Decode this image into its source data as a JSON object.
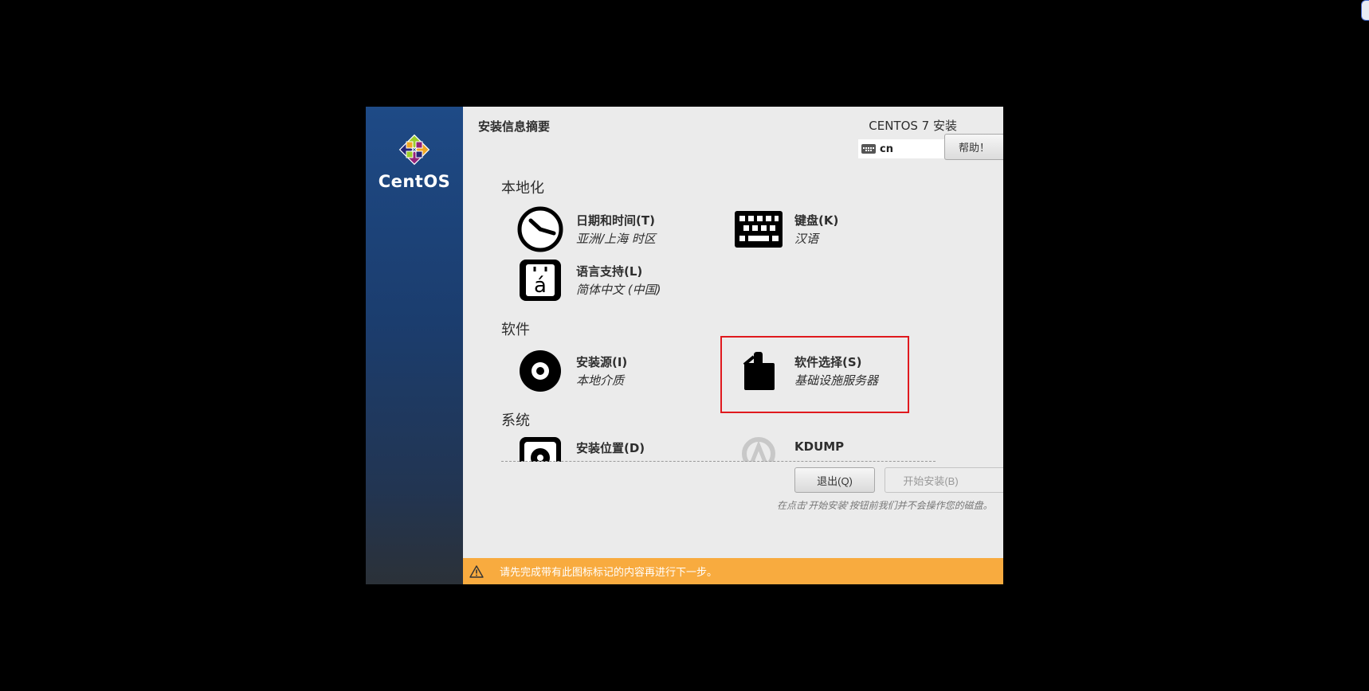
{
  "header": {
    "page_title": "安装信息摘要",
    "product_title": "CENTOS 7 安装",
    "keyboard_layout": "cn",
    "help_label": "帮助！"
  },
  "brand": {
    "name": "CentOS"
  },
  "sections": {
    "localization": {
      "title": "本地化",
      "datetime": {
        "title": "日期和时间(T)",
        "status": "亚洲/上海 时区"
      },
      "keyboard": {
        "title": "键盘(K)",
        "status": "汉语"
      },
      "language": {
        "title": "语言支持(L)",
        "status": "简体中文 (中国)"
      }
    },
    "software": {
      "title": "软件",
      "source": {
        "title": "安装源(I)",
        "status": "本地介质"
      },
      "selection": {
        "title": "软件选择(S)",
        "status": "基础设施服务器"
      }
    },
    "system": {
      "title": "系统",
      "destination": {
        "title": "安装位置(D)"
      },
      "kdump": {
        "title": "KDUMP"
      }
    }
  },
  "footer": {
    "quit_label": "退出(Q)",
    "begin_label": "开始安装(B)",
    "note": "在点击'开始安装'按钮前我们并不会操作您的磁盘。"
  },
  "warning": {
    "text": "请先完成带有此图标标记的内容再进行下一步。"
  },
  "colors": {
    "sidebar": "#1e4a86",
    "warning_bar": "#f8ab3f",
    "highlight": "#e0191e",
    "panel_bg": "#ebebeb"
  },
  "icons": [
    "clock-icon",
    "keyboard-icon",
    "language-icon",
    "disc-icon",
    "package-icon",
    "disk-icon",
    "kdump-icon",
    "warning-icon"
  ]
}
